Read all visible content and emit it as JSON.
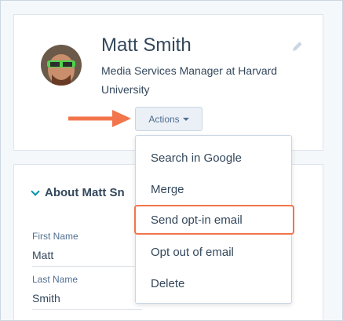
{
  "contact": {
    "name": "Matt Smith",
    "title": "Media Services Manager at Harvard University"
  },
  "actions": {
    "label": "Actions"
  },
  "about": {
    "title": "About Matt Sn",
    "fields": [
      {
        "label": "First Name",
        "value": "Matt"
      },
      {
        "label": "Last Name",
        "value": "Smith"
      }
    ]
  },
  "dropdown": {
    "items": [
      {
        "label": "Search in Google"
      },
      {
        "label": "Merge"
      },
      {
        "label": "Send opt-in email",
        "highlighted": true
      },
      {
        "label": "Opt out of email"
      },
      {
        "label": "Delete"
      }
    ]
  },
  "colors": {
    "accent": "#f2754b",
    "text": "#33475b",
    "button_bg": "#eaf0f6"
  },
  "icons": [
    "pencil-icon",
    "chevron-down-icon",
    "caret-down-icon",
    "arrow-right-icon"
  ]
}
